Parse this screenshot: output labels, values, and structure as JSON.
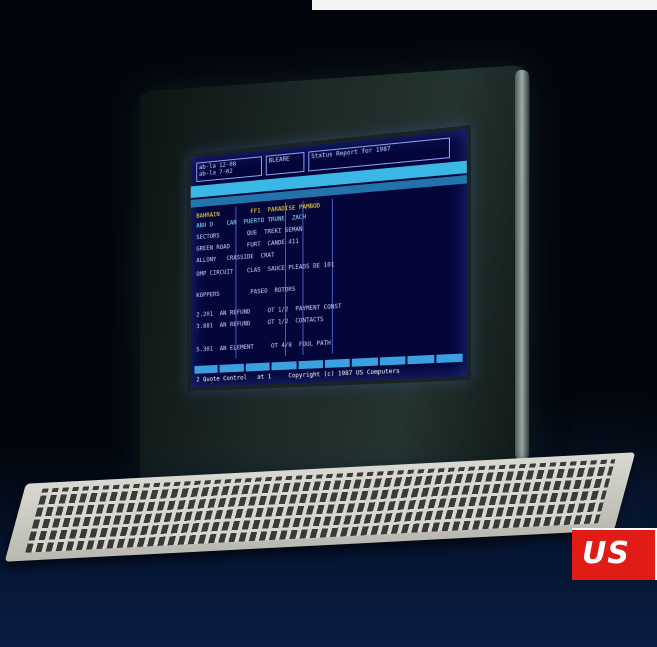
{
  "logo": {
    "text": "US"
  },
  "screen": {
    "header_boxes": [
      "ab-la 12-08\nab-la 7-02",
      "BLEARE",
      "Status Report for 1987"
    ],
    "rows": [
      {
        "text": "BAHRAIN         FF1  PARADISE PAMBOD",
        "style": "yellow"
      },
      {
        "text": "ABU D    CAR  PUERTO TRUNE  ZACH",
        "style": "cyan"
      },
      {
        "text": "SECTORS        QUE  TREKI SEMAN",
        "style": ""
      },
      {
        "text": "GREEN ROAD     FURT  CANDE 411",
        "style": ""
      },
      {
        "text": "ALLONY   CRASSIDE  CRAT",
        "style": ""
      },
      {
        "text": "OMP CIRCUIT    CLAS  SAUCE PLEADS DE 101",
        "style": ""
      },
      {
        "text": "KOPPERS         PASEO  ROTORS",
        "style": ""
      },
      {
        "text": "2.201  AN REFUND     OT 1/2  PAYMENT CONST",
        "style": ""
      },
      {
        "text": "3.881  AN REFUND     OT 1/2  CONTACTS",
        "style": ""
      },
      {
        "text": "S.301  AN ELEMENT     OT 4/8  FOUL PATH",
        "style": ""
      }
    ],
    "status_line": "2 Quote Control   at 1     Copyright (c) 1987 US Computers"
  }
}
